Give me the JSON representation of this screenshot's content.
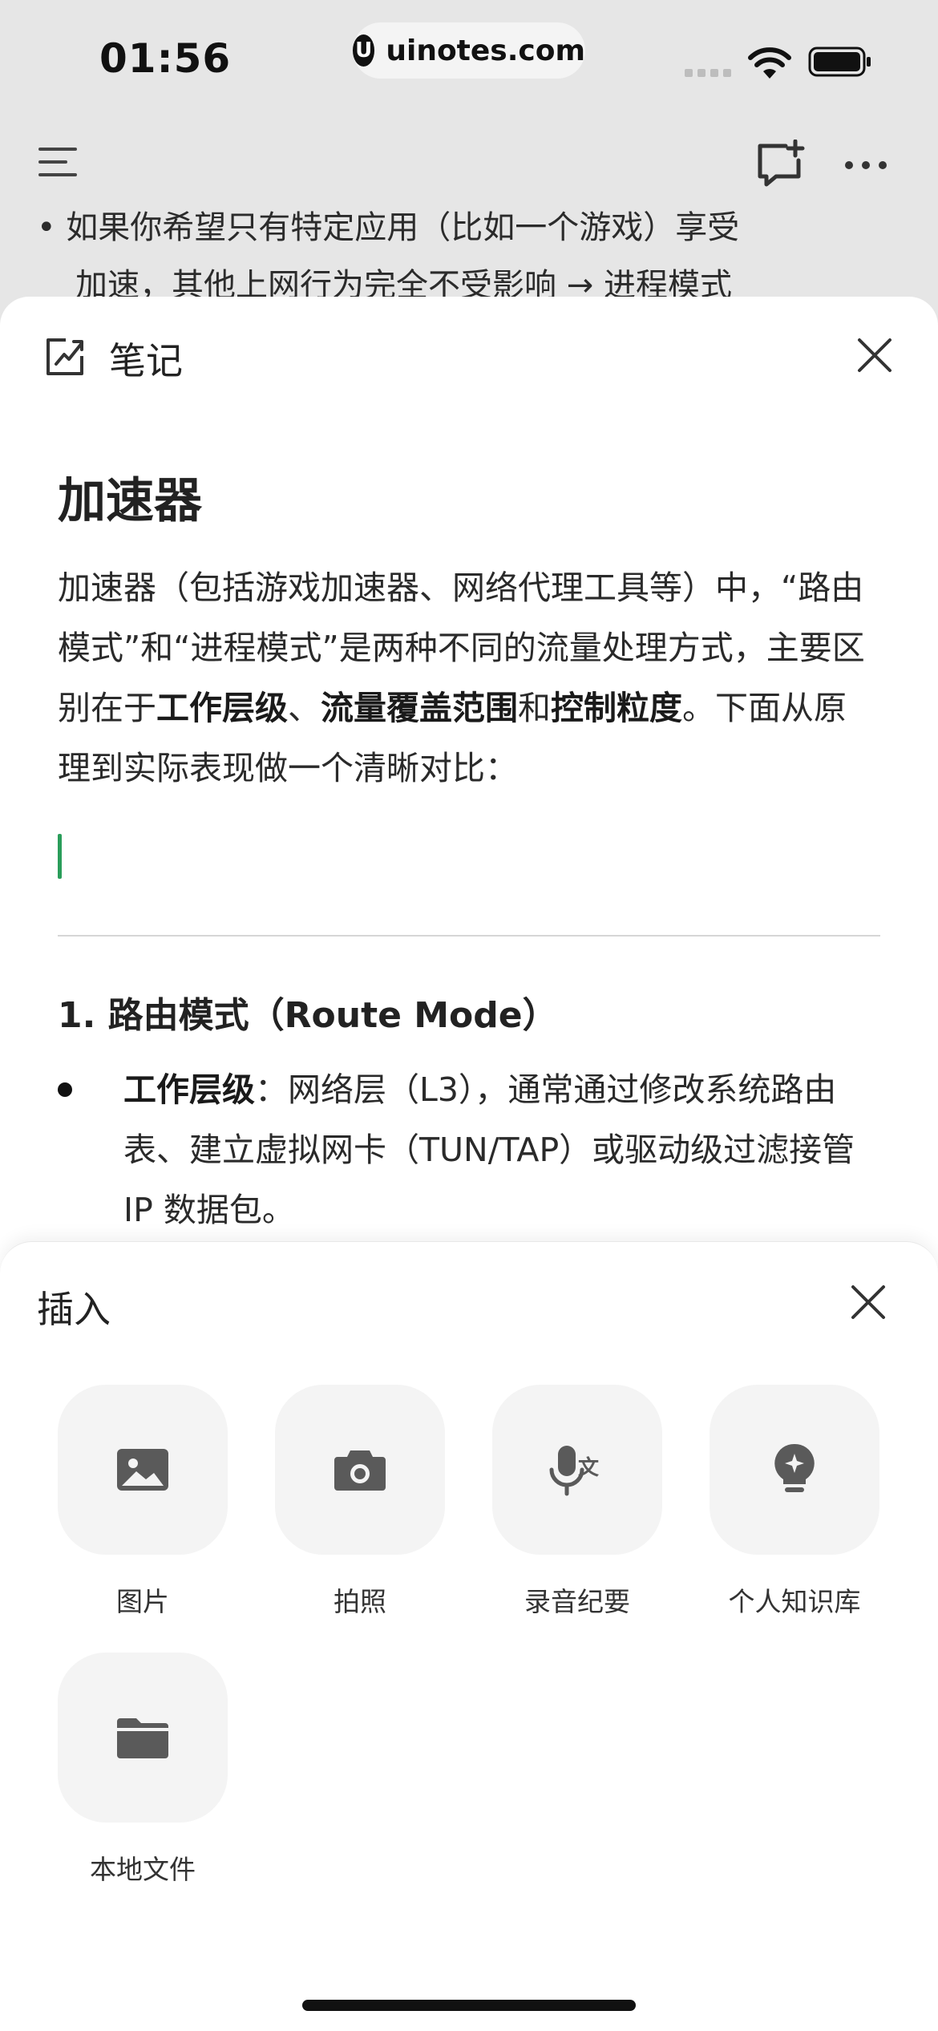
{
  "status_bar": {
    "time": "01:56",
    "url": "uinotes.com",
    "url_logo": "U"
  },
  "background_page": {
    "line1": "• 如果你希望只有特定应用（比如一个游戏）享受",
    "line2": "加速，其他上网行为完全不受影响 → 进程模式"
  },
  "note_panel": {
    "header_title": "笔记",
    "doc_title": "加速器",
    "para_parts": [
      "加速器（包括游戏加速器、网络代理工具等）中，“路由模式”和“进程模式”是两种不同的流量处理方式，主要区别在于",
      "工作层级",
      "、",
      "流量覆盖范围",
      "和",
      "控制粒度",
      "。下面从原理到实际表现做一个清晰对比："
    ],
    "section_title": "1. 路由模式（Route Mode）",
    "bullet": {
      "label": "工作层级",
      "text": "：网络层（L3），通常通过修改系统路由表、建立虚拟网卡（TUN/TAP）或驱动级过滤接管 IP 数据包。"
    }
  },
  "insert_sheet": {
    "title": "插入",
    "items": [
      {
        "label": "图片",
        "icon": "image-icon"
      },
      {
        "label": "拍照",
        "icon": "camera-icon"
      },
      {
        "label": "录音纪要",
        "icon": "voice-translate-icon"
      },
      {
        "label": "个人知识库",
        "icon": "lightbulb-icon"
      },
      {
        "label": "本地文件",
        "icon": "folder-icon"
      }
    ]
  },
  "colors": {
    "accent_cursor": "#2a9d5a",
    "tile_bg": "#f4f4f4",
    "icon_gray": "#595959"
  }
}
